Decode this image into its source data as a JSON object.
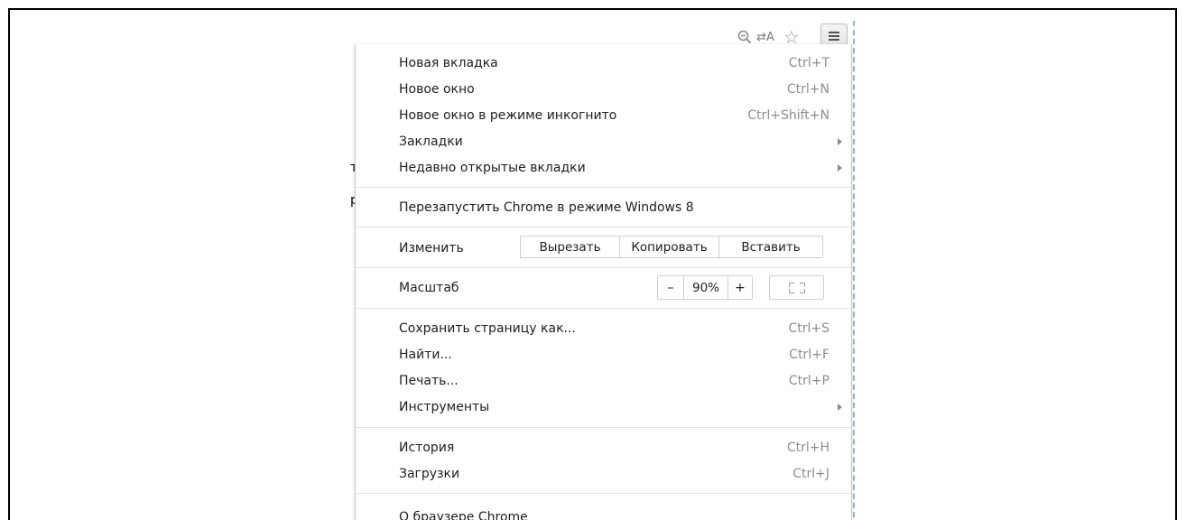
{
  "toolbar": {
    "icons": [
      "zoom-icon",
      "translate-icon",
      "bookmark-star-icon",
      "menu-icon"
    ],
    "translate_glyph": "⇄A",
    "star_glyph": "☆",
    "zoom_glyph": "⚲"
  },
  "page_edge_text": [
    "т",
    "р"
  ],
  "menu": {
    "items": [
      {
        "label": "Новая вкладка",
        "shortcut": "Ctrl+T"
      },
      {
        "label": "Новое окно",
        "shortcut": "Ctrl+N"
      },
      {
        "label": "Новое окно в режиме инкогнито",
        "shortcut": "Ctrl+Shift+N"
      },
      {
        "label": "Закладки",
        "submenu": true
      },
      {
        "label": "Недавно открытые вкладки",
        "submenu": true
      },
      {
        "label": "Перезапустить Chrome в режиме Windows 8"
      },
      {
        "label": "Сохранить страницу как...",
        "shortcut": "Ctrl+S"
      },
      {
        "label": "Найти...",
        "shortcut": "Ctrl+F"
      },
      {
        "label": "Печать...",
        "shortcut": "Ctrl+P"
      },
      {
        "label": "Инструменты",
        "submenu": true
      },
      {
        "label": "История",
        "shortcut": "Ctrl+H"
      },
      {
        "label": "Загрузки",
        "shortcut": "Ctrl+J"
      },
      {
        "label": "О браузере Chrome"
      }
    ],
    "edit": {
      "label": "Изменить",
      "cut": "Вырезать",
      "copy": "Копировать",
      "paste": "Вставить"
    },
    "zoom": {
      "label": "Масштаб",
      "minus": "–",
      "value": "90%",
      "plus": "+"
    }
  },
  "colors": {
    "menu_border": "#c8c8c8",
    "separator": "#e4e4e4",
    "shortcut_text": "#8d8d8d",
    "dashed_guide": "#9ab3d6"
  }
}
